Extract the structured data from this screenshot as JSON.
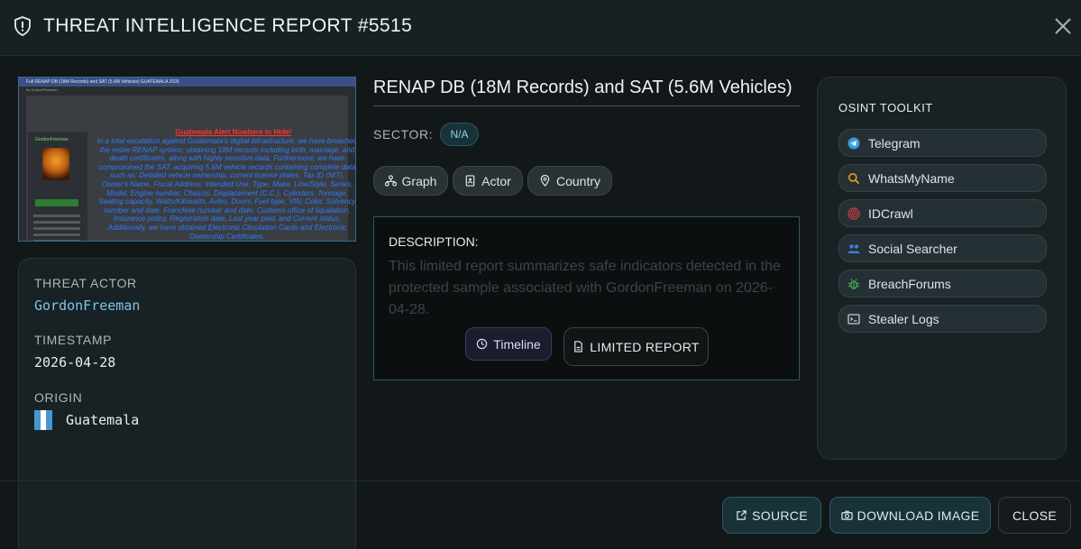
{
  "header": {
    "title": "THREAT INTELLIGENCE REPORT #5515",
    "icon": "shield-alert-icon",
    "close_icon": "close-icon"
  },
  "thumbnail": {
    "top_bar": "Full RENAP DB (18M Records) and SAT (5.6M Vehicles) GUATEMALA 2026",
    "subline": "by GordonFreeman",
    "alert": "Guatemala Alert Nowhere to Hide!",
    "author": "GordonFreeman",
    "body": "In a total escalation against Guatemala's digital infrastructure, we have breached the entire RENAP system, obtaining 18M records including birth, marriage, and death certificates, along with highly sensitive data. Furthermore, we have compromised the SAT, acquiring 5.6M vehicle records containing complete data such as: Detailed vehicle ownership, current license plates, Tax ID (NIT), Owner's Name, Fiscal Address, Intended Use, Type, Make, Line/Style, Series, Model, Engine number, Chassis, Displacement (C.C.), Cylinders, Tonnage, Seating capacity, Watts/Kilowatts, Axles, Doors, Fuel type, VIN, Color, Solvency number and date, Franchise number and date, Customs office of liquidation, Insurance policy, Registration date, Last year paid, and Current status. Additionally, we have obtained Electronic Circulation Cards and Electronic Ownership Certificates."
  },
  "info": {
    "threat_actor_label": "THREAT ACTOR",
    "threat_actor": "GordonFreeman",
    "timestamp_label": "TIMESTAMP",
    "timestamp": "2026-04-28",
    "origin_label": "ORIGIN",
    "origin": "Guatemala",
    "flag_colors": [
      "#4997d0",
      "#ffffff",
      "#4997d0"
    ]
  },
  "report": {
    "title": "RENAP DB (18M Records) and SAT (5.6M Vehicles)",
    "sector_label": "SECTOR:",
    "sector": "N/A",
    "pills": {
      "graph": "Graph",
      "actor": "Actor",
      "country": "Country"
    },
    "description_label": "DESCRIPTION:",
    "description": "This limited report summarizes safe indicators detected in the protected sample associated with GordonFreeman on 2026-04-28.",
    "timeline_label": "Timeline",
    "limited_label": "LIMITED REPORT"
  },
  "toolkit": {
    "title": "OSINT TOOLKIT",
    "items": [
      {
        "label": "Telegram",
        "icon": "telegram-icon",
        "color": "#3a9bdc"
      },
      {
        "label": "WhatsMyName",
        "icon": "search-icon",
        "color": "#e0a020"
      },
      {
        "label": "IDCrawl",
        "icon": "fingerprint-icon",
        "color": "#d04040"
      },
      {
        "label": "Social Searcher",
        "icon": "users-icon",
        "color": "#4a7ad8"
      },
      {
        "label": "BreachForums",
        "icon": "bug-icon",
        "color": "#3fa85a"
      },
      {
        "label": "Stealer Logs",
        "icon": "terminal-icon",
        "color": "#c8cdd0"
      }
    ]
  },
  "footer": {
    "source_label": "SOURCE",
    "download_label": "DOWNLOAD IMAGE",
    "close_label": "CLOSE"
  }
}
